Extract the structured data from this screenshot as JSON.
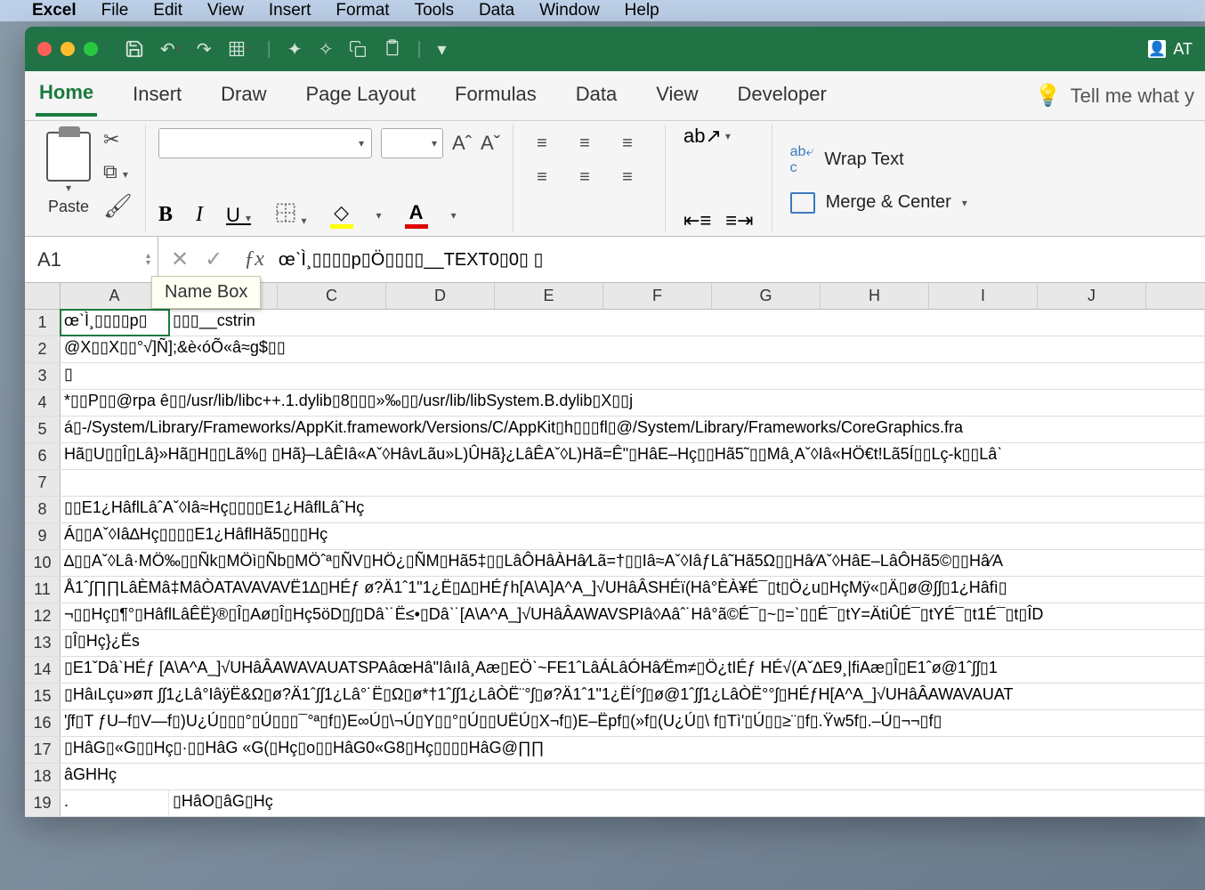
{
  "menubar": {
    "app": "Excel",
    "items": [
      "File",
      "Edit",
      "View",
      "Insert",
      "Format",
      "Tools",
      "Data",
      "Window",
      "Help"
    ]
  },
  "titlebar": {
    "right_label": "AT"
  },
  "ribbon": {
    "tabs": [
      "Home",
      "Insert",
      "Draw",
      "Page Layout",
      "Formulas",
      "Data",
      "View",
      "Developer"
    ],
    "tell_me": "Tell me what y",
    "paste_label": "Paste",
    "wrap_text": "Wrap Text",
    "merge_center": "Merge & Center"
  },
  "formula_bar": {
    "name_box": "A1",
    "name_tooltip": "Name Box",
    "formula": "œˋÌ¸▯▯▯▯p▯Ö▯▯▯▯__TEXT0▯0▯ ▯"
  },
  "columns": [
    "A",
    "B",
    "C",
    "D",
    "E",
    "F",
    "G",
    "H",
    "I",
    "J"
  ],
  "rows": [
    {
      "n": 1,
      "a": "œˋÌ¸▯▯▯▯p▯",
      "b": "▯▯▯__cstrin"
    },
    {
      "n": 2,
      "a": "@X▯▯X▯▯°√]Ñ];&è‹óÕ«â≈g$▯▯"
    },
    {
      "n": 3,
      "a": "▯"
    },
    {
      "n": 4,
      "a": "*▯▯P▯▯@rpa ê▯▯/usr/lib/libc++.1.dylib▯8▯▯▯»‰▯▯/usr/lib/libSystem.B.dylib▯X▯▯j"
    },
    {
      "n": 5,
      "a": "á▯-/System/Library/Frameworks/AppKit.framework/Versions/C/AppKit▯h▯▯▯fl▯@/System/Library/Frameworks/CoreGraphics.fra"
    },
    {
      "n": 6,
      "a": "Hã▯U▯▯Î▯Lâ}»Hã▯H▯▯Lã%▯ ▯Hã}–LâÊIâ«Aˇ◊HâvLãu»L)ÛHã}¿LâÊAˇ◊L)Hã=Ê\"▯HâE–Hç▯▯Hã5˜▯▯Mâ¸Aˇ◊Iâ«HÖ€t!Lã5Í▯▯Lç-k▯▯Lâˋ"
    },
    {
      "n": 7,
      "a": ""
    },
    {
      "n": 8,
      "a": "▯▯E1¿HâflLâˆAˇ◊Iâ≈Hç▯▯▯▯E1¿HâflLâˆHç"
    },
    {
      "n": 9,
      "a": "Á▯▯Aˇ◊Iâ∆Hç▯▯▯▯E1¿HâflHã5▯▯▯Hç"
    },
    {
      "n": 10,
      "a": "∆▯▯Aˇ◊Lâ·MÖ‰▯▯Ñk▯MÖì▯Ñb▯MÖˆª▯ÑV▯HÖ¿▯ÑM▯Hã5‡▯▯LâÔHâÀHâ⁄Lã=†▯▯Iâ≈Aˇ◊IâƒLâ˜Hã5Ω▯▯Hâ⁄Aˇ◊HâE–LâÔHã5©▯▯Hâ⁄A"
    },
    {
      "n": 11,
      "a": "Å1ˆ∫∏∏LâÈMâ‡MâÒATAVAVAVË1∆▯HÉƒ ø?Ä1ˆ1\"1¿Ë▯∆▯HÉƒh[A\\A]A^A_]√UHâÂSHÉï(Hâ°ÈÀ¥É¯▯t▯Ö¿u▯HçMÿ«▯Ä▯ø@∫ʃ▯1¿Hâfì▯"
    },
    {
      "n": 12,
      "a": "¬▯▯Hç▯¶°▯HâflLâÊË}®▯Î▯Aø▯Î▯Hç5öD▯∫▯Dâˋ˙Ë≤•▯Dâˋ˙[A\\A^A_]√UHâÂAWAVSPIâ◊Aâˆ˙Hâ°ã©É¯▯~▯=ˋ▯▯É¯▯tY=ÄtiÛÉ¯▯tYÉ¯▯t1É¯▯t▯ÎD"
    },
    {
      "n": 13,
      "a": "▯Î▯Hç}¿Ës"
    },
    {
      "n": 14,
      "a": "▯E1ˇDâˋHÉƒ [A\\A^A_]√UHâÂAWAVAUATSPAâœHâ\"IâıIâ¸Aæ▯EÖˋ~FE1ˆLâÁLâÓHâ⁄Ëm≠▯Ö¿tIÉƒ HÉ√(Aˇ∆E9¸|fiAæ▯Î▯E1ˆø@1ˆ∫ʃ▯1"
    },
    {
      "n": 15,
      "a": "▯HâıLçu»øπ ∫ʃ1¿Lâ°IâÿË&Ω▯ø?Ä1ˆ∫ʃ1¿Lâ°˙Ë▯Ω▯ø*†1ˆ∫ʃ1¿LâÒË¨°ʃ▯ø?Ä1ˆ1\"1¿ËÍ°ʃ▯ø@1ˆ∫ʃ1¿LâÒË°°ʃ▯HÉƒH[A^A_]√UHâÂAWAVAUAT"
    },
    {
      "n": 16,
      "a": "ʹʃf▯T ƒU–f▯V—f▯)U¿Ú▯▯▯°▯Ú▯▯▯¯°ª▯f▯)E∞Ú▯\\¬Ú▯Y▯▯°▯Ú▯▯UËÚ▯X¬f▯)E–Ëpf▯(»f▯(U¿Ú▯\\ f▯Tìʹ▯Ú▯▯≥¨▯f▯.Ÿw5f▯.–Ú▯¬¬▯f▯"
    },
    {
      "n": 17,
      "a": "▯HâG▯«G▯▯Hç▯·▯▯HâG «G(▯Hç▯o▯▯HâG0«G8▯Hç▯▯▯▯HâG@∏∏"
    },
    {
      "n": 18,
      "a": "âGHHç"
    },
    {
      "n": 19,
      "a": ".",
      "b": "▯HâO▯âG▯Hç"
    }
  ]
}
